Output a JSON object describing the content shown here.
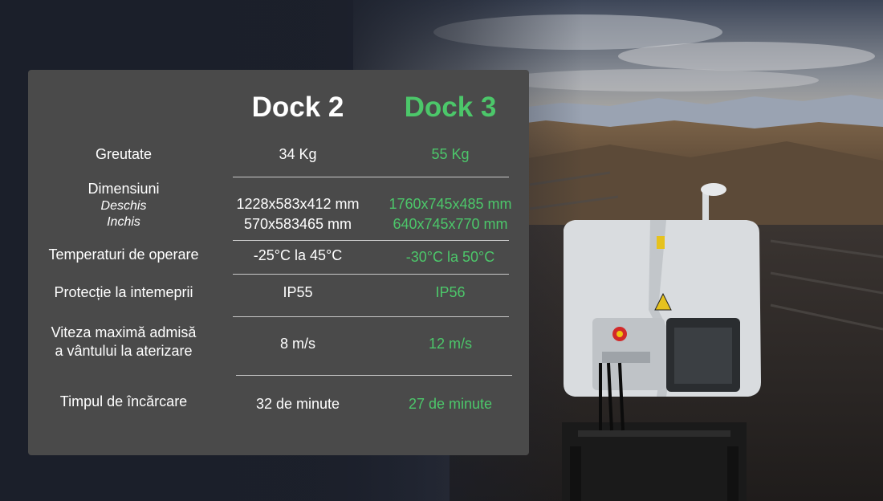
{
  "headers": {
    "dock2": "Dock 2",
    "dock3": "Dock 3"
  },
  "colors": {
    "accent": "#4cc76a",
    "card": "#4a4a4a",
    "text": "#ffffff"
  },
  "rows": [
    {
      "label": "Greutate",
      "dock2": "34 Kg",
      "dock3": "55 Kg"
    },
    {
      "label": "Dimensiuni",
      "sub_open": "Deschis",
      "sub_closed": "Inchis",
      "dock2_open": "1228x583x412 mm",
      "dock2_closed": "570x583465 mm",
      "dock3_open": "1760x745x485 mm",
      "dock3_closed": "640x745x770 mm"
    },
    {
      "label": "Temperaturi de operare",
      "dock2": "-25°C la 45°C",
      "dock3": "-30°C la 50°C"
    },
    {
      "label": "Protecție la intemeprii",
      "dock2": "IP55",
      "dock3": "IP56"
    },
    {
      "label_line1": "Viteza maximă admisă",
      "label_line2": "a vântului la aterizare",
      "dock2": "8 m/s",
      "dock3": "12 m/s"
    },
    {
      "label": "Timpul de încărcare",
      "dock2": "32 de minute",
      "dock3": "27 de minute"
    }
  ]
}
